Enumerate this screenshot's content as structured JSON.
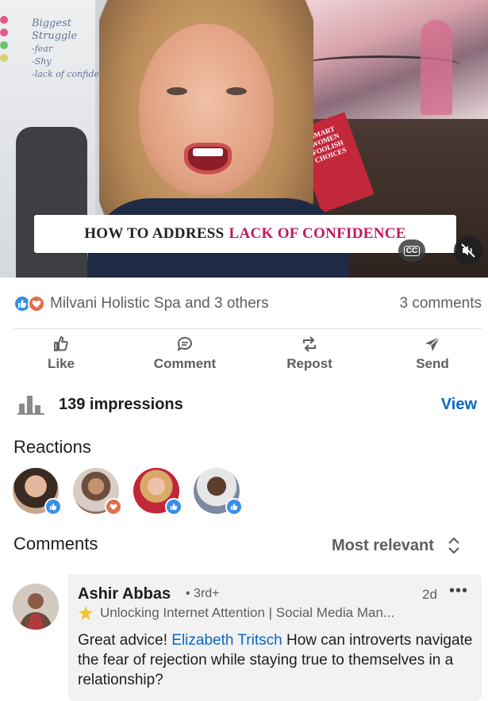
{
  "video": {
    "whiteboard_lines": [
      "Biggest Struggle",
      "-fear",
      "-Shy",
      "-lack of confidence"
    ],
    "book_title": "SMART WOMEN FOOLISH CHOICES",
    "caption_dark": "HOW TO ADDRESS",
    "caption_pink": "LACK OF CONFIDENCE",
    "cc_label": "CC",
    "mute_icon": "speaker-muted-icon",
    "accent_color": "#c2185b"
  },
  "social": {
    "reactions_text": "Milvani Holistic Spa and 3 others",
    "comments_count": "3 comments"
  },
  "actions": [
    {
      "label": "Like",
      "icon": "thumbs-up-icon"
    },
    {
      "label": "Comment",
      "icon": "comment-icon"
    },
    {
      "label": "Repost",
      "icon": "repost-icon"
    },
    {
      "label": "Send",
      "icon": "send-icon"
    }
  ],
  "impressions": {
    "text": "139 impressions",
    "view_label": "View",
    "link_color": "#0a66c2"
  },
  "reactions_section": {
    "title": "Reactions",
    "reactors": [
      {
        "reaction": "like"
      },
      {
        "reaction": "love"
      },
      {
        "reaction": "like"
      },
      {
        "reaction": "like"
      }
    ]
  },
  "comments_section": {
    "title": "Comments",
    "sort_label": "Most relevant"
  },
  "comment": {
    "author": "Ashir Abbas",
    "degree": "• 3rd+",
    "time": "2d",
    "more": "•••",
    "headline": "Unlocking Internet Attention | Social Media Man...",
    "text_before": "Great advice! ",
    "mention": "Elizabeth Tritsch",
    "text_after": "  How can introverts navigate the fear of rejection while staying true to themselves in a relationship?"
  }
}
